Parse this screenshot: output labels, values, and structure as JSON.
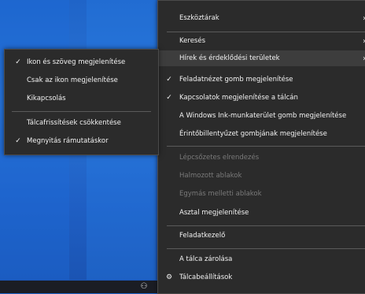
{
  "colors": {
    "menu_bg": "#2b2b2b",
    "desktop_blue": "#2a74d6",
    "taskbar": "#1b1d24"
  },
  "context_menu": {
    "items": [
      {
        "label": "Eszköztárak",
        "checked": false,
        "disabled": false,
        "submenu": true
      },
      {
        "label": "Keresés",
        "checked": false,
        "disabled": false,
        "submenu": true
      },
      {
        "label": "Hírek és érdeklődési területek",
        "checked": false,
        "disabled": false,
        "submenu": true,
        "highlighted": true
      },
      {
        "label": "Feladatnézet gomb megjelenítése",
        "checked": true,
        "disabled": false
      },
      {
        "label": "Kapcsolatok megjelenítése a tálcán",
        "checked": true,
        "disabled": false
      },
      {
        "label": "A Windows Ink-munkaterület gomb megjelenítése",
        "checked": false,
        "disabled": false
      },
      {
        "label": "Érintőbillentyűzet gombjának megjelenítése",
        "checked": false,
        "disabled": false
      },
      {
        "label": "Lépcsőzetes elrendezés",
        "checked": false,
        "disabled": true
      },
      {
        "label": "Halmozott ablakok",
        "checked": false,
        "disabled": true
      },
      {
        "label": "Egymás melletti ablakok",
        "checked": false,
        "disabled": true
      },
      {
        "label": "Asztal megjelenítése",
        "checked": false,
        "disabled": false
      },
      {
        "label": "Feladatkezelő",
        "checked": false,
        "disabled": false
      },
      {
        "label": "A tálca zárolása",
        "checked": false,
        "disabled": false
      },
      {
        "label": "Tálcabeállítások",
        "checked": false,
        "disabled": false,
        "icon": "gear-icon"
      }
    ],
    "check_glyph": "✓",
    "submenu_arrow": "›"
  },
  "submenu": {
    "items": [
      {
        "label": "Ikon és szöveg megjelenítése",
        "checked": true
      },
      {
        "label": "Csak az ikon megjelenítése",
        "checked": false
      },
      {
        "label": "Kikapcsolás",
        "checked": false
      },
      {
        "label": "Tálcafrissítések csökkentése",
        "checked": false
      },
      {
        "label": "Megnyitás rámutatáskor",
        "checked": true
      }
    ]
  },
  "taskbar": {
    "people_icon": "people-icon"
  }
}
